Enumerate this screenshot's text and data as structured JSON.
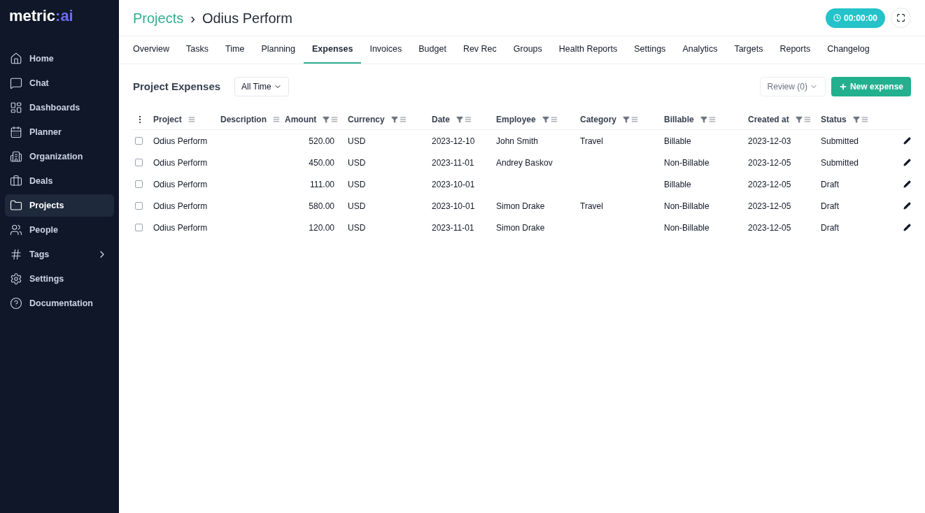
{
  "logo": {
    "word": "metric",
    "colon": ":",
    "suffix": "ai"
  },
  "sidebar": {
    "items": [
      {
        "label": "Home",
        "selected": false,
        "submenu": false
      },
      {
        "label": "Chat",
        "selected": false,
        "submenu": false
      },
      {
        "label": "Dashboards",
        "selected": false,
        "submenu": false
      },
      {
        "label": "Planner",
        "selected": false,
        "submenu": false
      },
      {
        "label": "Organization",
        "selected": false,
        "submenu": false
      },
      {
        "label": "Deals",
        "selected": false,
        "submenu": false
      },
      {
        "label": "Projects",
        "selected": true,
        "submenu": false
      },
      {
        "label": "People",
        "selected": false,
        "submenu": false
      },
      {
        "label": "Tags",
        "selected": false,
        "submenu": true
      },
      {
        "label": "Settings",
        "selected": false,
        "submenu": false
      },
      {
        "label": "Documentation",
        "selected": false,
        "submenu": false
      }
    ]
  },
  "breadcrumb": {
    "parent": "Projects",
    "separator": "›",
    "current": "Odius Perform"
  },
  "timer": "00:00:00",
  "tabs": [
    {
      "label": "Overview",
      "selected": false
    },
    {
      "label": "Tasks",
      "selected": false
    },
    {
      "label": "Time",
      "selected": false
    },
    {
      "label": "Planning",
      "selected": false
    },
    {
      "label": "Expenses",
      "selected": true
    },
    {
      "label": "Invoices",
      "selected": false
    },
    {
      "label": "Budget",
      "selected": false
    },
    {
      "label": "Rev Rec",
      "selected": false
    },
    {
      "label": "Groups",
      "selected": false
    },
    {
      "label": "Health Reports",
      "selected": false
    },
    {
      "label": "Settings",
      "selected": false
    },
    {
      "label": "Analytics",
      "selected": false
    },
    {
      "label": "Targets",
      "selected": false
    },
    {
      "label": "Reports",
      "selected": false
    },
    {
      "label": "Changelog",
      "selected": false
    }
  ],
  "section": {
    "title": "Project Expenses",
    "period": "All Time",
    "review": "Review (0)",
    "new_button": "New expense"
  },
  "table": {
    "columns": [
      {
        "label": "Project",
        "filterable": false
      },
      {
        "label": "Description",
        "filterable": false
      },
      {
        "label": "Amount",
        "filterable": true
      },
      {
        "label": "Currency",
        "filterable": true
      },
      {
        "label": "Date",
        "filterable": true
      },
      {
        "label": "Employee",
        "filterable": true
      },
      {
        "label": "Category",
        "filterable": true
      },
      {
        "label": "Billable",
        "filterable": true
      },
      {
        "label": "Created at",
        "filterable": true
      },
      {
        "label": "Status",
        "filterable": true
      }
    ],
    "rows": [
      {
        "checked": false,
        "cells": [
          "Odius Perform",
          null,
          "520.00",
          "USD",
          "2023-12-10",
          "John Smith",
          "Travel",
          "Billable",
          "2023-12-03",
          "Submitted"
        ]
      },
      {
        "checked": false,
        "cells": [
          "Odius Perform",
          null,
          "450.00",
          "USD",
          "2023-11-01",
          "Andrey Baskov",
          null,
          "Non-Billable",
          "2023-12-05",
          "Submitted"
        ]
      },
      {
        "checked": false,
        "cells": [
          "Odius Perform",
          null,
          "111.00",
          "USD",
          "2023-10-01",
          null,
          null,
          "Billable",
          "2023-12-05",
          "Draft"
        ]
      },
      {
        "checked": false,
        "cells": [
          "Odius Perform",
          null,
          "580.00",
          "USD",
          "2023-10-01",
          "Simon Drake",
          "Travel",
          "Non-Billable",
          "2023-12-05",
          "Draft"
        ]
      },
      {
        "checked": false,
        "cells": [
          "Odius Perform",
          null,
          "120.00",
          "USD",
          "2023-11-01",
          "Simon Drake",
          null,
          "Non-Billable",
          "2023-12-05",
          "Draft"
        ]
      }
    ]
  }
}
